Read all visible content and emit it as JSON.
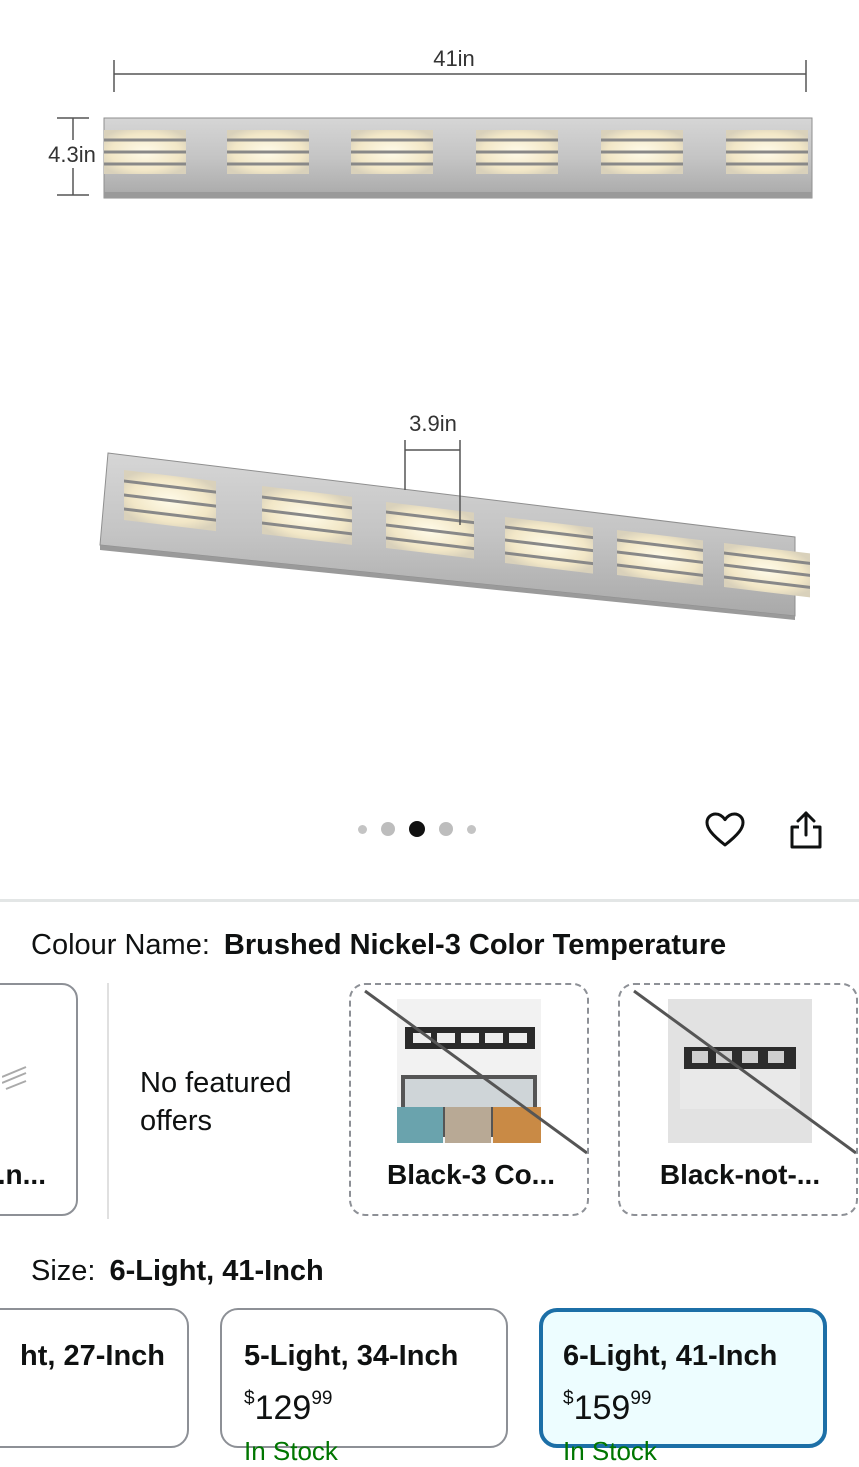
{
  "gallery": {
    "dimension_width": "41in",
    "dimension_height": "4.3in",
    "dimension_spacing": "3.9in",
    "image_count": 5,
    "active_image": 3,
    "wishlist_icon": "heart-icon",
    "share_icon": "share-icon"
  },
  "colour": {
    "label": "Colour Name:",
    "selected": "Brushed Nickel-3 Color Temperature",
    "options": [
      {
        "name": "...n...",
        "available": true
      },
      {
        "name": "No featured offers",
        "available": true
      },
      {
        "name": "Black-3 Co...",
        "available": false
      },
      {
        "name": "Black-not-...",
        "available": false
      }
    ]
  },
  "size": {
    "label": "Size:",
    "selected": "6-Light, 41-Inch",
    "options": [
      {
        "name": "ht, 27-Inch",
        "price_currency": "",
        "price_whole": "",
        "price_fraction": "",
        "stock": ""
      },
      {
        "name": "5-Light, 34-Inch",
        "price_currency": "$",
        "price_whole": "129",
        "price_fraction": "99",
        "stock": "In Stock"
      },
      {
        "name": "6-Light, 41-Inch",
        "price_currency": "$",
        "price_whole": "159",
        "price_fraction": "99",
        "stock": "In Stock"
      }
    ]
  },
  "colors": {
    "accent": "#1c6fa7",
    "selected_bg": "#edfdff",
    "border": "#8d9096",
    "text": "#0f1111",
    "stock": "#007600"
  }
}
